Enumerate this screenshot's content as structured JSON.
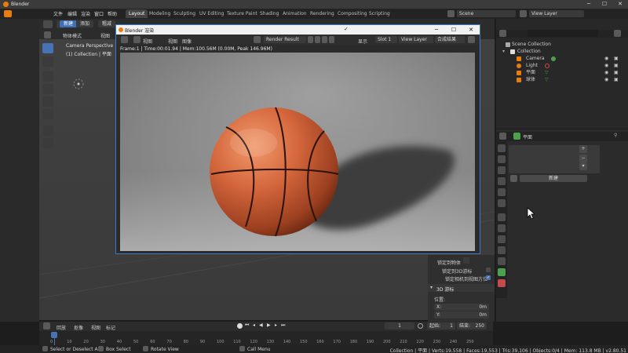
{
  "window": {
    "title": "Blender"
  },
  "menu": {
    "items": [
      "文件",
      "编辑",
      "渲染",
      "窗口",
      "帮助"
    ],
    "workspaces": [
      "Layout",
      "Modeling",
      "Sculpting",
      "UV Editing",
      "Texture Paint",
      "Shading",
      "Animation",
      "Rendering",
      "Compositing",
      "Scripting"
    ],
    "active_workspace": "Layout",
    "scene": "Scene",
    "view_layer": "View Layer"
  },
  "viewport": {
    "mode": "物体模式",
    "view": "视图",
    "new_btn": "新建",
    "add_btn": "添加",
    "extra_btn": "粗减",
    "overlay_title": "Camera Perspective",
    "overlay_sub": "(1) Collection | 平面"
  },
  "outliner": {
    "root": "Scene Collection",
    "collection": "Collection",
    "items": [
      "Camera",
      "Light",
      "平面",
      "球体"
    ]
  },
  "properties": {
    "object_name": "平面",
    "new_btn": "新建"
  },
  "npanel": {
    "lock_to_object": "锁定到物体",
    "lock_3d_cursor": "锁定到3D游标",
    "lock_camera": "锁定相机到视图方位",
    "section_3d_cursor": "3D 游标",
    "location": "位置:",
    "x_label": "X:",
    "x_value": "0m",
    "y_label": "Y:",
    "y_value": "0m"
  },
  "render_window": {
    "title": "Blender 渲染",
    "view_menu": "视图",
    "view_menu2": "视图",
    "image_menu": "图像",
    "render_result": "Render Result",
    "display": "显示",
    "slot": "Slot 1",
    "view_layer": "View Layer",
    "pass": "合成结果",
    "info": "Frame:1 | Time:00:01.94 | Mem:100.56M (0.00M, Peak 146.96M)"
  },
  "timeline": {
    "playback": "回放",
    "keying": "抠像",
    "view": "视图",
    "marker": "标记",
    "current_frame": "1",
    "start_label": "起始:",
    "start": "1",
    "end_label": "结束:",
    "end": "250",
    "ticks": [
      "0",
      "10",
      "20",
      "30",
      "40",
      "50",
      "60",
      "70",
      "80",
      "90",
      "100",
      "110",
      "120",
      "130",
      "140",
      "150",
      "160",
      "170",
      "180",
      "190",
      "200",
      "210",
      "220",
      "230",
      "240",
      "250"
    ]
  },
  "status": {
    "select": "Select or Deselect All",
    "box_select": "Box Select",
    "rotate": "Rotate View",
    "call_menu": "Call Menu",
    "stats": "Collection | 平面 | Verts:19,558 | Faces:19,553 | Tris:39,106 | Objects:0/4 | Mem: 113.8 MB | v2.80.51"
  },
  "colors": {
    "accent": "#4772b3",
    "basketball": "#d4663c",
    "blender_orange": "#e87d0d"
  }
}
